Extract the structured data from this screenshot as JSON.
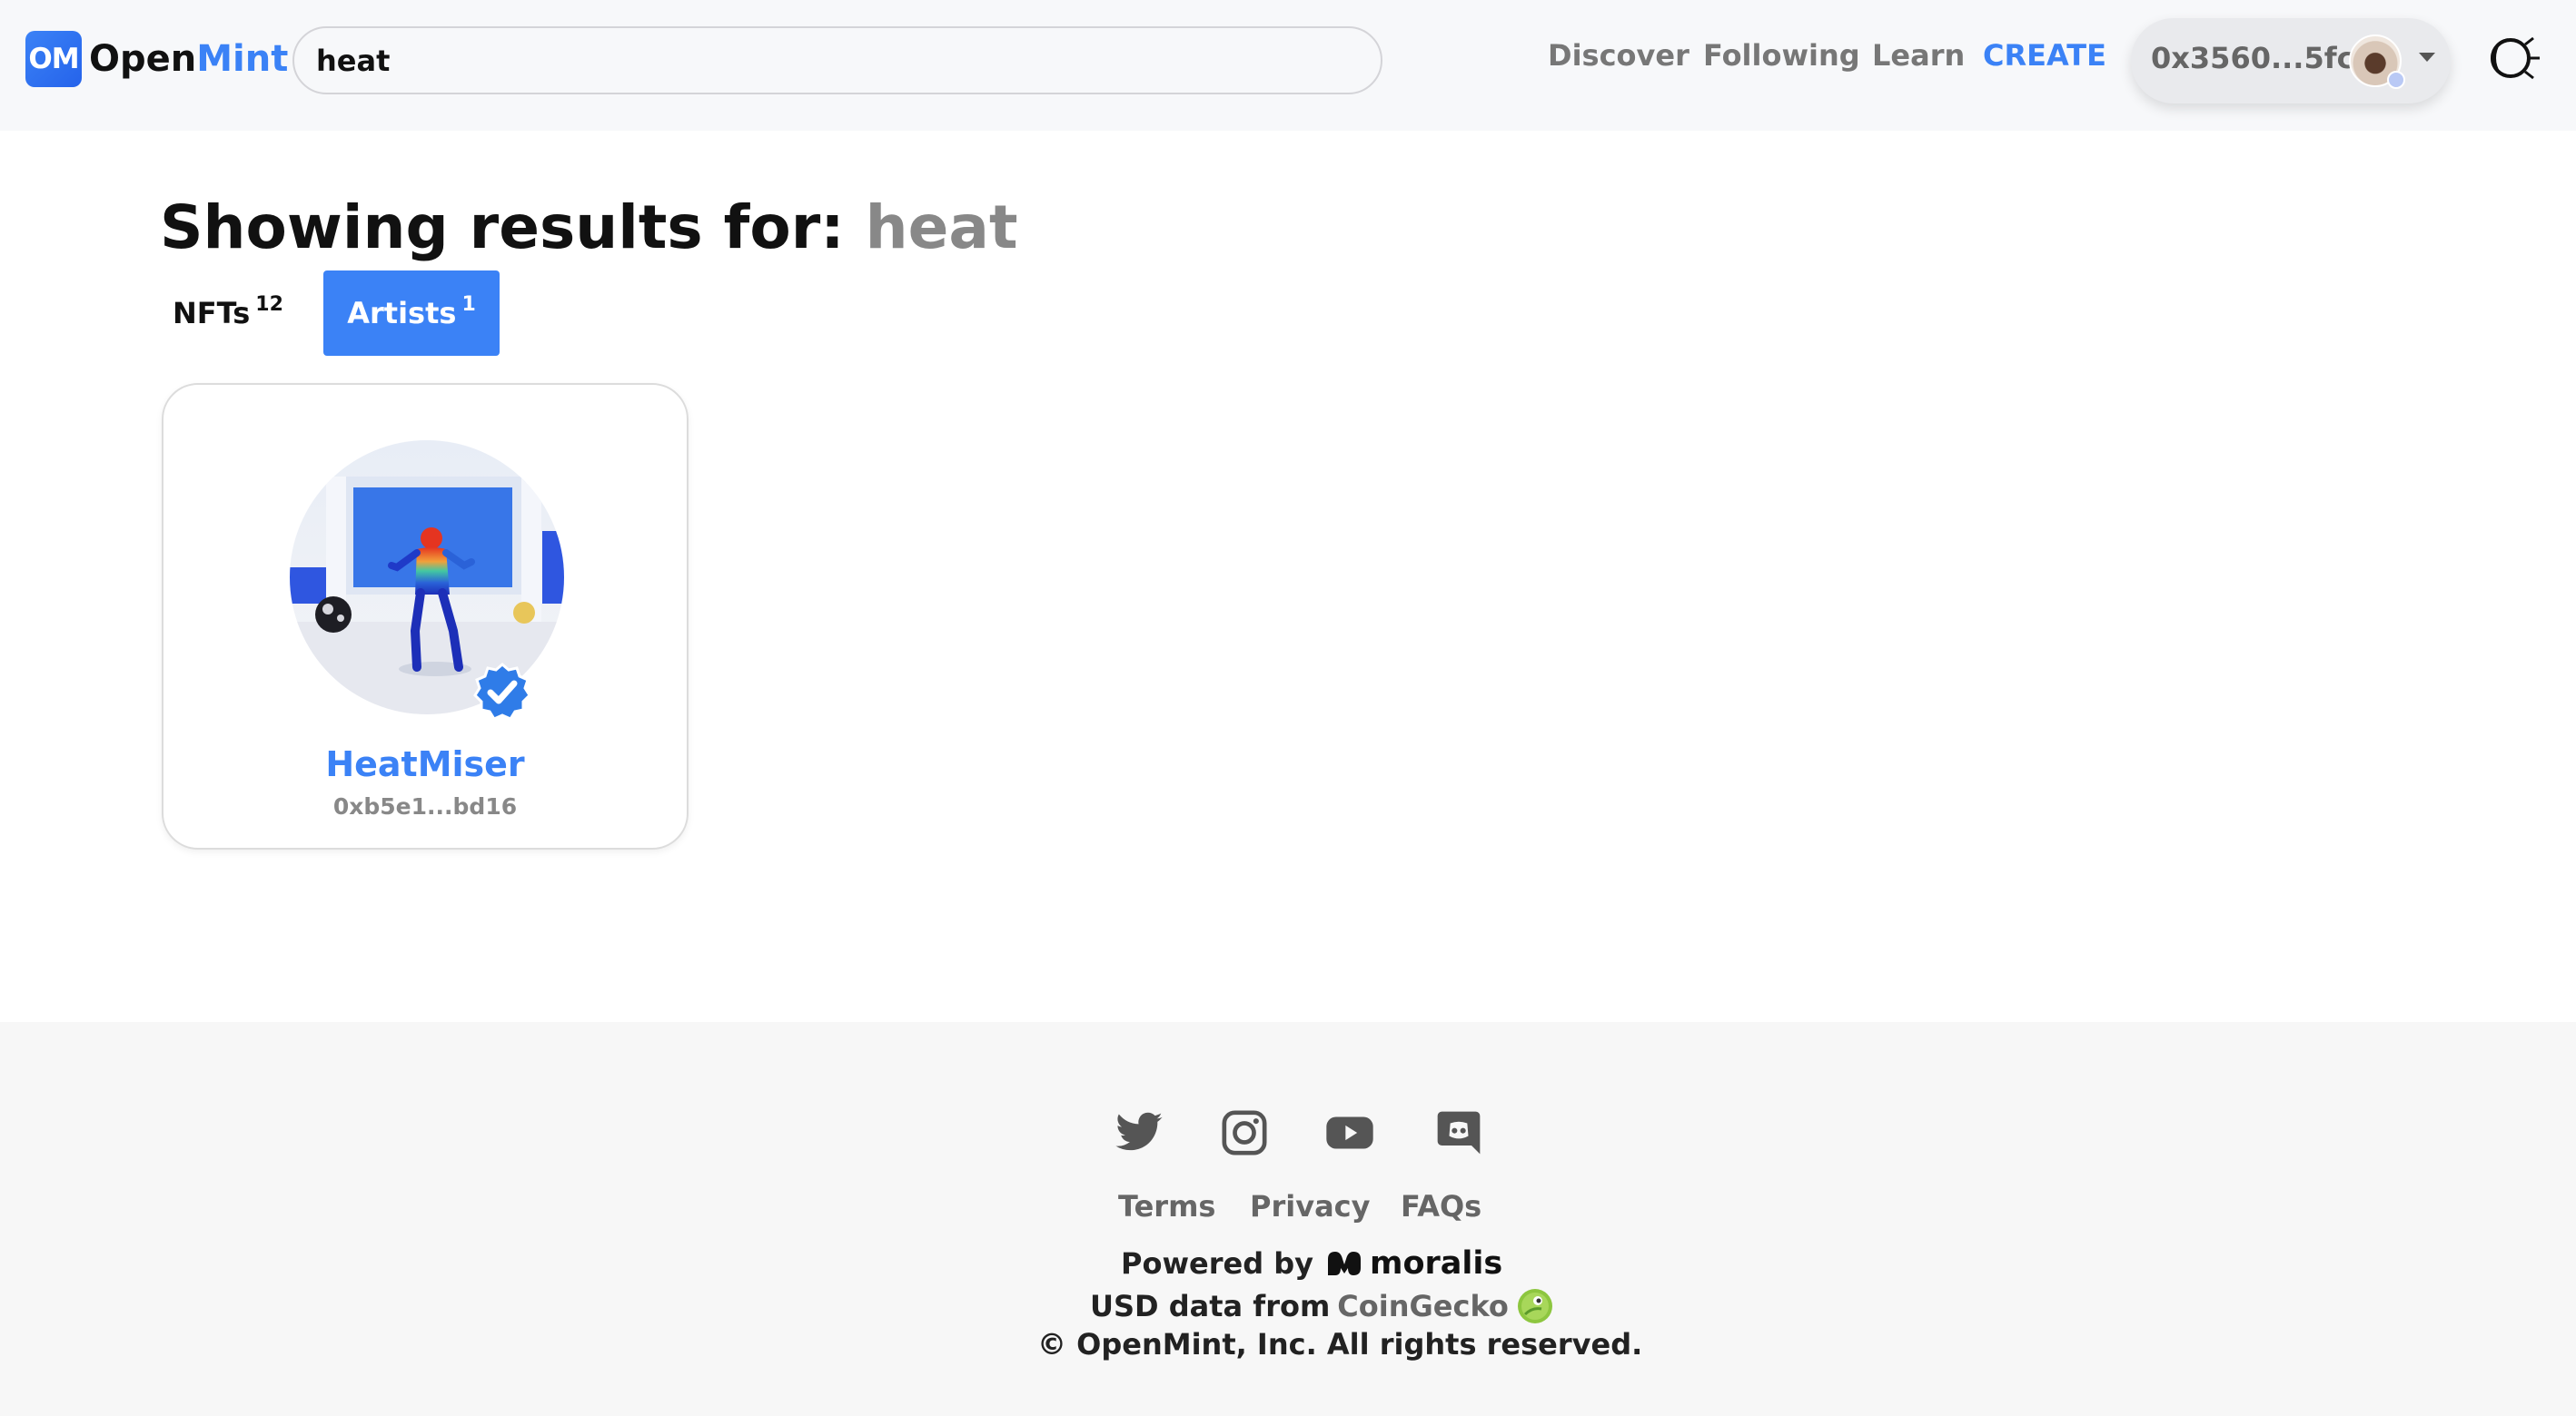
{
  "header": {
    "logo_badge": "OM",
    "logo_open": "Open",
    "logo_mint": "Mint",
    "search_value": "heat",
    "nav": {
      "discover": "Discover",
      "following": "Following",
      "learn": "Learn",
      "create": "CREATE"
    },
    "wallet_address": "0x3560...5fc",
    "theme_icon": "half-moon-sun-icon"
  },
  "results": {
    "label": "Showing results for: ",
    "query": "heat",
    "tabs": [
      {
        "label": "NFTs",
        "count": "12",
        "active": false
      },
      {
        "label": "Artists",
        "count": "1",
        "active": true
      }
    ]
  },
  "artists": [
    {
      "name": "HeatMiser",
      "address": "0xb5e1...bd16",
      "verified": true
    }
  ],
  "footer": {
    "social_icons": [
      "twitter-icon",
      "instagram-icon",
      "youtube-icon",
      "discord-icon"
    ],
    "links": {
      "terms": "Terms",
      "privacy": "Privacy",
      "faqs": "FAQs"
    },
    "powered_by": "Powered by",
    "powered_brand": "moralis",
    "usd_data": "USD data from",
    "usd_source": "CoinGecko",
    "copyright": "© OpenMint, Inc. All rights reserved."
  },
  "colors": {
    "accent": "#3b82f6",
    "header_bg": "#f7f8fa",
    "footer_bg": "#f7f7f7",
    "muted_text": "#777777"
  }
}
